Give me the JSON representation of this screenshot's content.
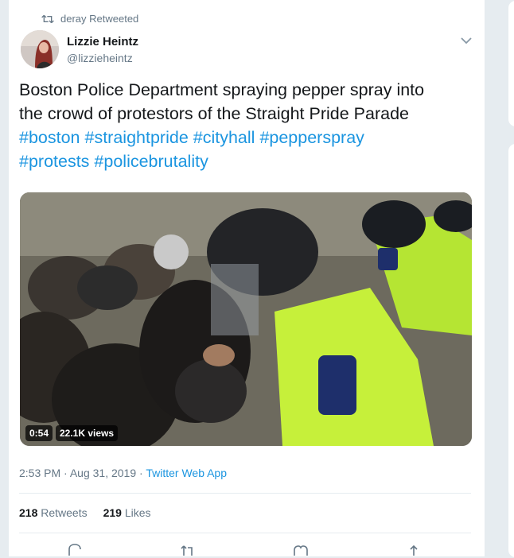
{
  "retweet_context": {
    "text": "deray Retweeted"
  },
  "author": {
    "name": "Lizzie Heintz",
    "handle": "@lizzieheintz"
  },
  "tweet": {
    "text_line1": "Boston Police Department spraying pepper spray into",
    "text_line2": "the crowd of protestors of the Straight Pride Parade",
    "hashtags": [
      "#boston",
      "#straightpride",
      "#cityhall",
      "#pepperspray",
      "#protests",
      "#policebrutality"
    ]
  },
  "media": {
    "duration": "0:54",
    "views": "22.1K views"
  },
  "meta": {
    "time": "2:53 PM",
    "date": "Aug 31, 2019",
    "separator": "·",
    "source": "Twitter Web App"
  },
  "stats": {
    "retweets_count": "218",
    "retweets_label": "Retweets",
    "likes_count": "219",
    "likes_label": "Likes"
  },
  "icons": [
    "retweet-icon",
    "chevron-down-icon",
    "reply-icon",
    "like-icon",
    "share-icon"
  ],
  "colors": {
    "link": "#1b95e0",
    "muted": "#657786",
    "text": "#14171a",
    "background": "#e6ecf0"
  }
}
